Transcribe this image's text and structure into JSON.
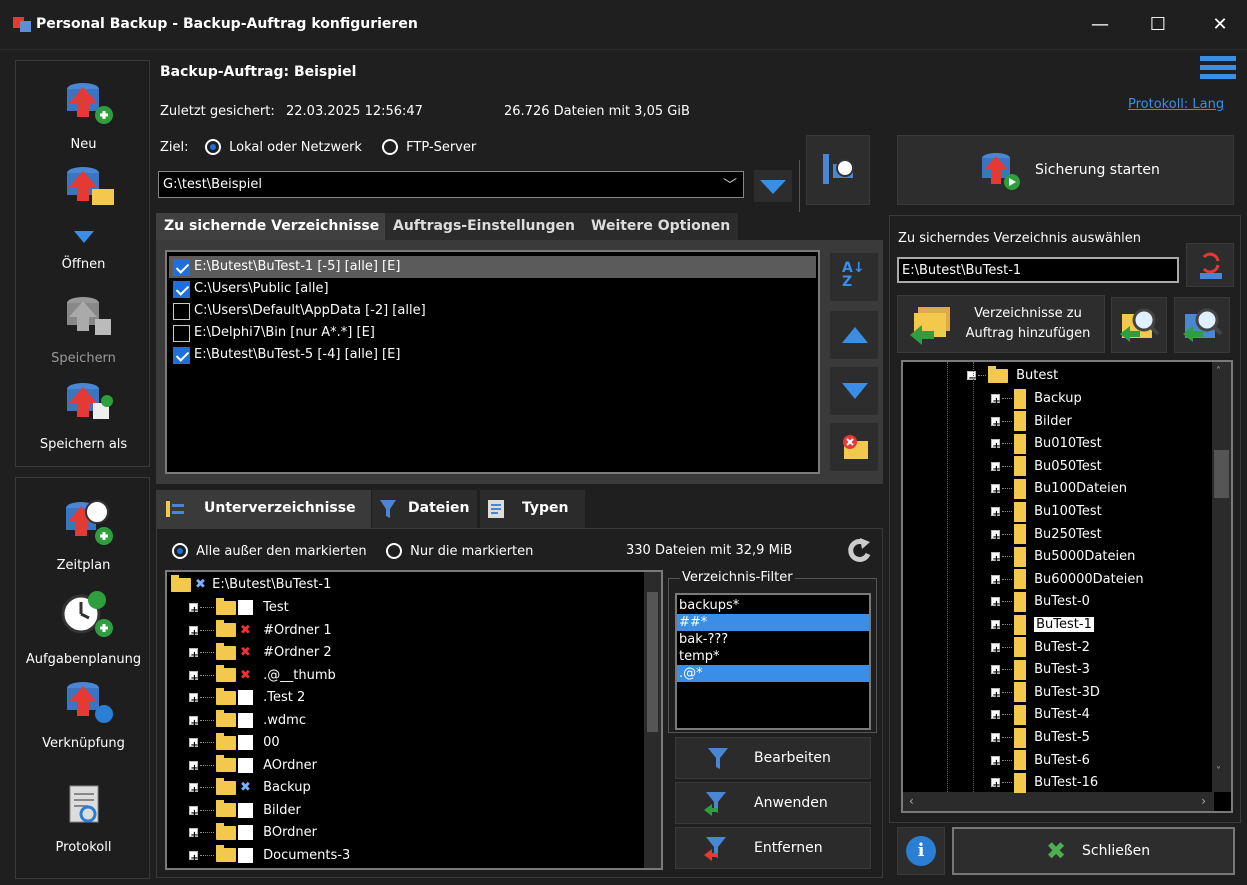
{
  "window": {
    "title": "Personal Backup - Backup-Auftrag konfigurieren",
    "minimize": "—",
    "maximize": "☐",
    "close": "✕"
  },
  "left_toolbar": {
    "new": "Neu",
    "open": "Öffnen",
    "save": "Speichern",
    "save_as": "Speichern als",
    "schedule": "Zeitplan",
    "task_planning": "Aufgabenplanung",
    "shortcut": "Verknüpfung",
    "log": "Protokoll"
  },
  "header": {
    "job": "Backup-Auftrag: Beispiel",
    "last_saved_label": "Zuletzt gesichert:",
    "last_saved": "22.03.2025 12:56:47",
    "files_info": "26.726 Dateien mit 3,05 GiB",
    "protocol_link": "Protokoll: Lang",
    "target_label": "Ziel:",
    "radio_local": "Lokal oder Netzwerk",
    "radio_ftp": "FTP-Server",
    "target_path": "G:\\test\\Beispiel"
  },
  "tabs": [
    "Zu sichernde Verzeichnisse",
    "Auftrags-Einstellungen",
    "Weitere Optionen"
  ],
  "dir_list": [
    {
      "checked": true,
      "text": "E:\\Butest\\BuTest-1 [-5] [alle] [E]",
      "selected": true
    },
    {
      "checked": true,
      "text": "C:\\Users\\Public [alle]",
      "selected": false
    },
    {
      "checked": false,
      "text": "C:\\Users\\Default\\AppData [-2] [alle]",
      "selected": false
    },
    {
      "checked": false,
      "text": "E:\\Delphi7\\Bin [nur A*.*] [E]",
      "selected": false
    },
    {
      "checked": true,
      "text": "E:\\Butest\\BuTest-5 [-4] [alle] [E]",
      "selected": false
    }
  ],
  "subtabs": [
    "Unterverzeichnisse",
    "Dateien",
    "Typen"
  ],
  "sub_radio": {
    "all_except": "Alle außer den markierten",
    "only_marked": "Nur die markierten",
    "count": "330 Dateien mit 32,9 MiB"
  },
  "subtree": {
    "root": "E:\\Butest\\BuTest-1",
    "items": [
      {
        "name": "Test",
        "mark": "empty"
      },
      {
        "name": "#Ordner 1",
        "mark": "x"
      },
      {
        "name": "#Ordner 2",
        "mark": "x"
      },
      {
        "name": ".@__thumb",
        "mark": "x"
      },
      {
        "name": ".Test 2",
        "mark": "empty"
      },
      {
        "name": ".wdmc",
        "mark": "empty"
      },
      {
        "name": "00",
        "mark": "empty"
      },
      {
        "name": "AOrdner",
        "mark": "empty"
      },
      {
        "name": "Backup",
        "mark": "b"
      },
      {
        "name": "Bilder",
        "mark": "empty"
      },
      {
        "name": "BOrdner",
        "mark": "empty"
      },
      {
        "name": "Documents-3",
        "mark": "empty"
      }
    ]
  },
  "filter": {
    "title": "Verzeichnis-Filter",
    "items": [
      {
        "text": "backups*",
        "selected": false
      },
      {
        "text": "##*",
        "selected": true
      },
      {
        "text": "bak-???",
        "selected": false
      },
      {
        "text": "temp*",
        "selected": false
      },
      {
        "text": ".@*",
        "selected": true
      }
    ],
    "edit": "Bearbeiten",
    "apply": "Anwenden",
    "remove": "Entfernen"
  },
  "right": {
    "start": "Sicherung starten",
    "select_label": "Zu sicherndes Verzeichnis auswählen",
    "selected_path": "E:\\Butest\\BuTest-1",
    "add_btn_line1": "Verzeichnisse zu",
    "add_btn_line2": "Auftrag hinzufügen",
    "tree_root": "Butest",
    "tree_items": [
      "Backup",
      "Bilder",
      "Bu010Test",
      "Bu050Test",
      "Bu100Dateien",
      "Bu100Test",
      "Bu250Test",
      "Bu5000Dateien",
      "Bu60000Dateien",
      "BuTest-0",
      "BuTest-1",
      "BuTest-2",
      "BuTest-3",
      "BuTest-3D",
      "BuTest-4",
      "BuTest-5",
      "BuTest-6",
      "BuTest-16"
    ],
    "tree_selected_index": 10,
    "close": "Schließen"
  },
  "colors": {
    "accent": "#1e6fd9",
    "selection": "#3a8ee6"
  }
}
